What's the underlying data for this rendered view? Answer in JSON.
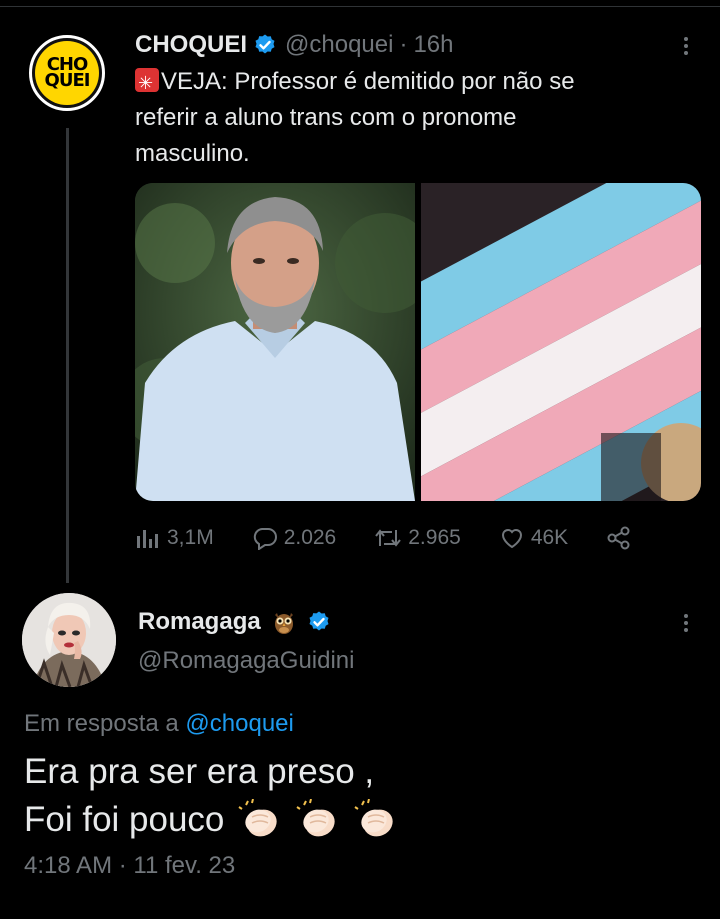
{
  "tweet1": {
    "avatar_text_top": "CHO",
    "avatar_text_bottom": "QUEI",
    "name": "CHOQUEI",
    "handle": "@choquei",
    "separator": "·",
    "time": "16h",
    "text_line1": "VEJA: Professor é demitido por não se",
    "text_line2": "referir a aluno trans com o pronome",
    "text_line3": "masculino.",
    "siren_icon": "police-light-emoji",
    "stats": {
      "views": "3,1M",
      "replies": "2.026",
      "retweets": "2.965",
      "likes": "46K"
    }
  },
  "tweet2": {
    "name": "Romagaga",
    "owl_icon": "owl-emoji",
    "handle": "@RomagagaGuidini",
    "reply_prefix": "Em resposta a",
    "reply_handle": "@choquei",
    "text_line1": "Era pra ser era preso ,",
    "text_line2": "Foi foi pouco",
    "timestamp": "4:18 AM · 11 fev. 23"
  },
  "colors": {
    "background": "#000000",
    "text": "#e7e9ea",
    "muted": "#71767b",
    "accent": "#1d9bf0",
    "logo_yellow": "#ffd600"
  }
}
